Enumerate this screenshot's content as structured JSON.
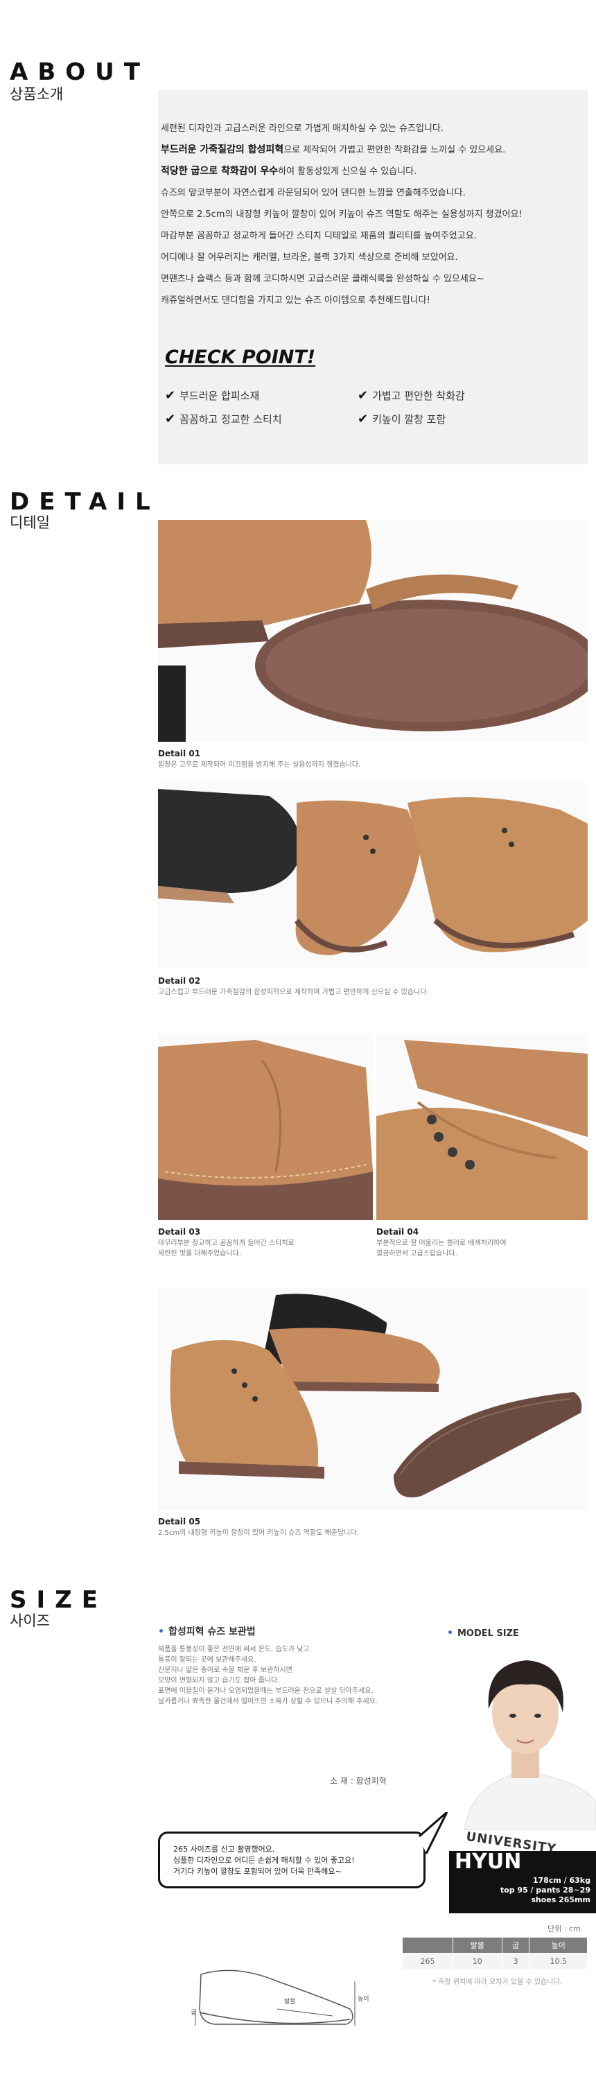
{
  "about": {
    "title": "ABOUT",
    "subtitle": "상품소개",
    "lines": [
      [
        "",
        "세련된 디자인과 고급스러운 라인으로 가볍게 매치하실 수 있는 슈즈입니다."
      ],
      [
        "부드러운 가죽질감의 합성피혁",
        "으로 제작되어 가볍고 편안한 착화감을 느끼실 수 있으세요."
      ],
      [
        "적당한 굽으로 착화감이 우수",
        "하여 활동성있게 신으실 수 있습니다."
      ],
      [
        "",
        "슈즈의 앞코부분이 자연스럽게 라운딩되어 있어 댄디한 느낌을 연출해주었습니다."
      ],
      [
        "",
        "안쪽으로 2.5cm의 내장형 키높이 깔창이 있어 키높이 슈즈 역할도 해주는 실용성까지 챙겼어요!"
      ],
      [
        "",
        "마감부분 꼼꼼하고 정교하게 들어간 스티치 디테일로 제품의 퀄리티를 높여주었고요."
      ],
      [
        "",
        "어디에나 잘 어우러지는 캐러멜, 브라운, 블랙 3가지 색상으로 준비해 보았어요."
      ],
      [
        "",
        "면팬츠나 슬랙스 등과 함께 코디하시면 고급스러운 클래식룩을 완성하실 수 있으세요~"
      ],
      [
        "",
        "캐쥬얼하면서도 댄디함을 가지고 있는 슈즈 아이템으로 추천해드립니다!"
      ]
    ],
    "checkpoint_title": "CHECK POINT!",
    "check_items": [
      "부드러운 합피소재",
      "가볍고 편안한 착화감",
      "꼼꼼하고 정교한 스티치",
      "키높이 깔창 포함"
    ]
  },
  "detail": {
    "title": "DETAIL",
    "subtitle": "디테일",
    "items": [
      {
        "label": "Detail 01",
        "text": "밑창은 고무로 제작되어 미끄럼을 방지해 주는 실용성까지 챙겼습니다."
      },
      {
        "label": "Detail 02",
        "text": "고급스럽고 부드러운 가죽질감의 합성피혁으로 제작하여 가볍고 편안하게 신으실 수 있습니다."
      },
      {
        "label": "Detail 03",
        "text": "마무리부분 정교하고 꼼꼼하게 들어간 스티치로",
        "text2": "세련된 멋을 더해주었습니다."
      },
      {
        "label": "Detail 04",
        "text": "부분적으로 잘 어울리는 컬러로 배색처리하여",
        "text2": "깔끔하면서 고급스럽습니다."
      },
      {
        "label": "Detail 05",
        "text": "2.5cm의 내장형 키높이 깔창이 있어 키높이 슈즈 역할도 해준답니다."
      }
    ]
  },
  "size": {
    "title": "SIZE",
    "subtitle": "사이즈",
    "care_title": "합성피혁 슈즈 보관법",
    "care_lines": [
      "제품을 통풍성이 좋은 천연에 싸서 온도, 습도가 낮고",
      "통풍이 잘되는 곳에 보관해주세요.",
      "신문지나 얇은 종이로 속을 채운 후 보관하시면",
      "모양이 변형되지 않고 습기도 잡아 줍니다.",
      "표면에 이물질이 묻거나 오염되었을때는 부드러운 천으로 살살 닦아주세요.",
      "날카롭거나 뾰족한 물건에서 떨어뜨면 소재가 상할 수 있으니 주의해 주세요."
    ],
    "material": "소  재 : 합성피혁",
    "speech": [
      "265 사이즈를 신고 촬영했어요.",
      "심플한 디자인으로 어디든 손쉽게 매치할 수 있어 좋고요!",
      "거기다 키높이 깔창도 포함되어 있어 더욱 만족해요~"
    ],
    "model_title": "MODEL SIZE",
    "model_name": "HYUN",
    "model_stats": [
      "178cm / 63kg",
      "top 95 / pants 28~29",
      "shoes 265mm"
    ],
    "shirt_text": "UNIVERSITY",
    "unit": "단위 : cm",
    "table_headers": [
      "",
      "발볼",
      "굽",
      "높이"
    ],
    "table_row": [
      "265",
      "10",
      "3",
      "10.5"
    ],
    "diagram_labels": {
      "ball": "발볼",
      "height": "높이",
      "heel": "굽"
    },
    "note": "* 측정 위치에 따라 오차가 있을 수 있습니다."
  },
  "colors": {
    "caramel": "#c58a5d",
    "sole": "#7a5349",
    "box_bg": "#f1f1f1",
    "accent_blue": "#3a6fc4"
  }
}
